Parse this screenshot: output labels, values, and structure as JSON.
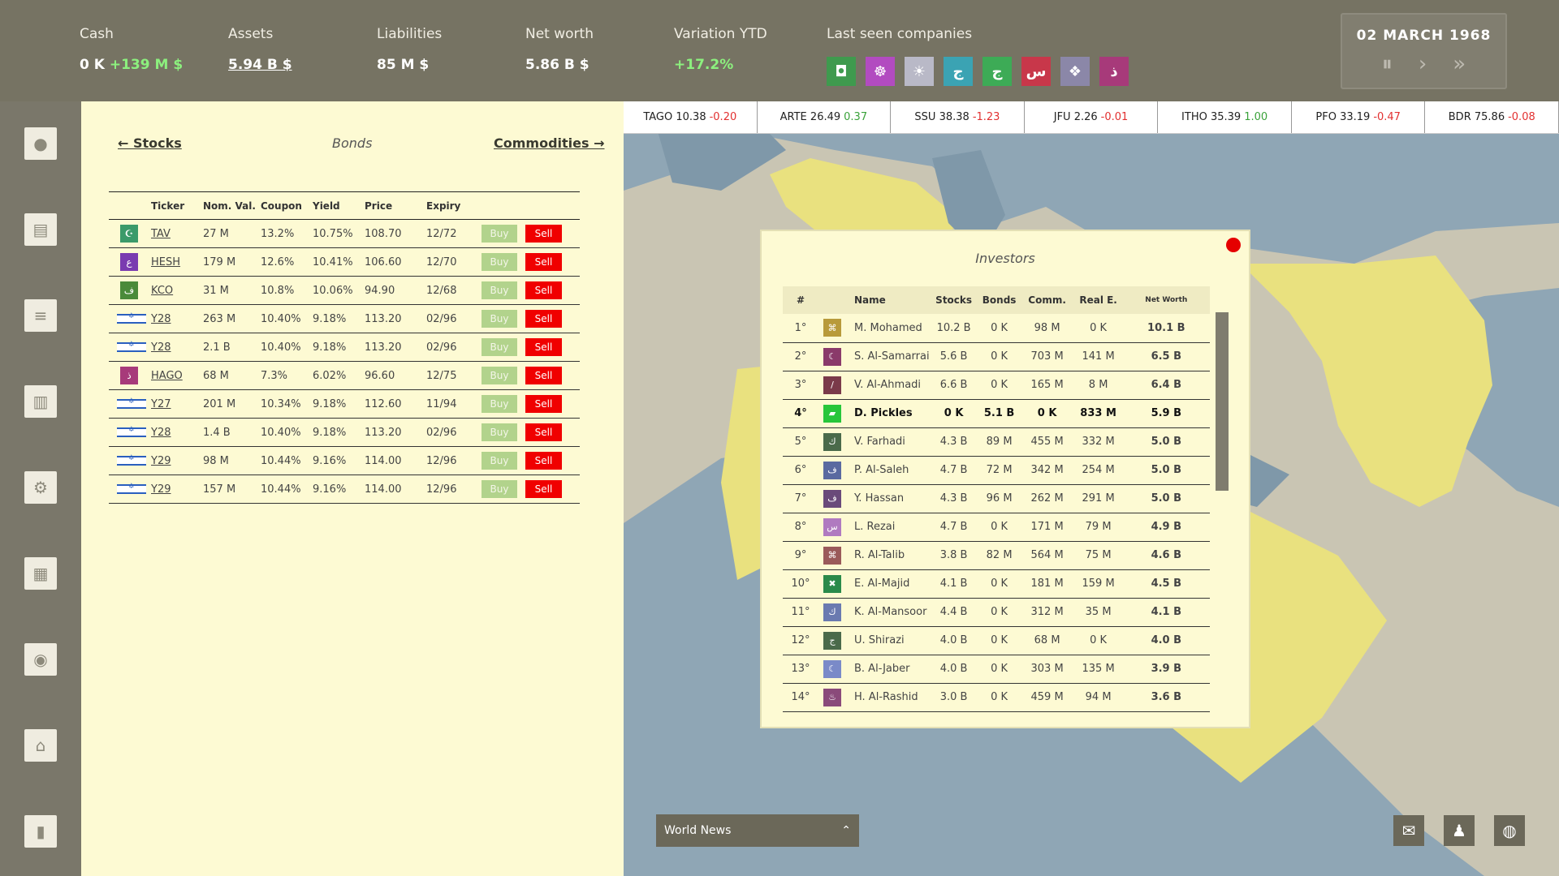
{
  "header": {
    "cash_label": "Cash",
    "cash_value": "0 K",
    "cash_change": "+139 M $",
    "assets_label": "Assets",
    "assets_value": "5.94 B $",
    "liabilities_label": "Liabilities",
    "liabilities_value": "85 M $",
    "networth_label": "Net worth",
    "networth_value": "5.86 B $",
    "variation_label": "Variation YTD",
    "variation_value": "+17.2%",
    "lastseen_label": "Last seen companies",
    "companies": [
      {
        "icon": "◘",
        "color": "#3f9a4e"
      },
      {
        "icon": "☸",
        "color": "#b24bc0"
      },
      {
        "icon": "☀",
        "color": "#b9b9c7"
      },
      {
        "icon": "ج",
        "color": "#3ba3b3"
      },
      {
        "icon": "ج",
        "color": "#3dab56"
      },
      {
        "icon": "س",
        "color": "#c8374a"
      },
      {
        "icon": "❖",
        "color": "#8b87a8"
      },
      {
        "icon": "ذ",
        "color": "#a73a7a"
      }
    ]
  },
  "date": {
    "text": "02 MARCH 1968",
    "pause": "⏸",
    "play": "›",
    "fast": "»"
  },
  "sidebar": [
    "person-icon",
    "document-icon",
    "database-icon",
    "news-icon",
    "gear-icon",
    "building-icon",
    "money-bag-icon",
    "bank-icon",
    "chart-icon"
  ],
  "nav": {
    "stocks": "← Stocks",
    "bonds": "Bonds",
    "commodities": "Commodities →"
  },
  "bonds": {
    "headers": [
      "Ticker",
      "Nom. Val.",
      "Coupon",
      "Yield",
      "Price",
      "Expiry"
    ],
    "buy_label": "Buy",
    "sell_label": "Sell",
    "rows": [
      {
        "ticker": "TAV",
        "nom": "27 M",
        "coupon": "13.2%",
        "yield": "10.75%",
        "price": "108.70",
        "expiry": "12/72",
        "icon": "☪",
        "color": "#3b9a6a"
      },
      {
        "ticker": "HESH",
        "nom": "179 M",
        "coupon": "12.6%",
        "yield": "10.41%",
        "price": "106.60",
        "expiry": "12/70",
        "icon": "ع",
        "color": "#7a3bb0"
      },
      {
        "ticker": "KCO",
        "nom": "31 M",
        "coupon": "10.8%",
        "yield": "10.06%",
        "price": "94.90",
        "expiry": "12/68",
        "icon": "ﻑ",
        "color": "#4a8a3a"
      },
      {
        "ticker": "Y28",
        "nom": "263 M",
        "coupon": "10.40%",
        "yield": "9.18%",
        "price": "113.20",
        "expiry": "02/96",
        "icon": "",
        "color": "flag"
      },
      {
        "ticker": "Y28",
        "nom": "2.1 B",
        "coupon": "10.40%",
        "yield": "9.18%",
        "price": "113.20",
        "expiry": "02/96",
        "icon": "",
        "color": "flag"
      },
      {
        "ticker": "HAGO",
        "nom": "68 M",
        "coupon": "7.3%",
        "yield": "6.02%",
        "price": "96.60",
        "expiry": "12/75",
        "icon": "ذ",
        "color": "#a73a7a"
      },
      {
        "ticker": "Y27",
        "nom": "201 M",
        "coupon": "10.34%",
        "yield": "9.18%",
        "price": "112.60",
        "expiry": "11/94",
        "icon": "",
        "color": "flag"
      },
      {
        "ticker": "Y28",
        "nom": "1.4 B",
        "coupon": "10.40%",
        "yield": "9.18%",
        "price": "113.20",
        "expiry": "02/96",
        "icon": "",
        "color": "flag"
      },
      {
        "ticker": "Y29",
        "nom": "98 M",
        "coupon": "10.44%",
        "yield": "9.16%",
        "price": "114.00",
        "expiry": "12/96",
        "icon": "",
        "color": "flag"
      },
      {
        "ticker": "Y29",
        "nom": "157 M",
        "coupon": "10.44%",
        "yield": "9.16%",
        "price": "114.00",
        "expiry": "12/96",
        "icon": "",
        "color": "flag"
      }
    ]
  },
  "ticker": [
    {
      "sym": "TAGO",
      "price": "10.38",
      "chg": "-0.20",
      "dir": "neg"
    },
    {
      "sym": "ARTE",
      "price": "26.49",
      "chg": "0.37",
      "dir": "pos"
    },
    {
      "sym": "SSU",
      "price": "38.38",
      "chg": "-1.23",
      "dir": "neg"
    },
    {
      "sym": "JFU",
      "price": "2.26",
      "chg": "-0.01",
      "dir": "neg"
    },
    {
      "sym": "ITHO",
      "price": "35.39",
      "chg": "1.00",
      "dir": "pos"
    },
    {
      "sym": "PFO",
      "price": "33.19",
      "chg": "-0.47",
      "dir": "neg"
    },
    {
      "sym": "BDR",
      "price": "75.86",
      "chg": "-0.08",
      "dir": "neg"
    }
  ],
  "investors": {
    "title": "Investors",
    "headers": [
      "#",
      "",
      "Name",
      "Stocks",
      "Bonds",
      "Comm.",
      "Real E.",
      "Net Worth"
    ],
    "rows": [
      {
        "rank": "1°",
        "name": "M. Mohamed",
        "stocks": "10.2 B",
        "bonds": "0 K",
        "comm": "98 M",
        "re": "0 K",
        "nw": "10.1 B",
        "icon": "⌘",
        "color": "#b89a3a"
      },
      {
        "rank": "2°",
        "name": "S. Al-Samarrai",
        "stocks": "5.6 B",
        "bonds": "0 K",
        "comm": "703 M",
        "re": "141 M",
        "nw": "6.5 B",
        "icon": "☾",
        "color": "#8a3a6a"
      },
      {
        "rank": "3°",
        "name": "V. Al-Ahmadi",
        "stocks": "6.6 B",
        "bonds": "0 K",
        "comm": "165 M",
        "re": "8 M",
        "nw": "6.4 B",
        "icon": "/",
        "color": "#7a3a4a"
      },
      {
        "rank": "4°",
        "name": "D. Pickles",
        "stocks": "0 K",
        "bonds": "5.1 B",
        "comm": "0 K",
        "re": "833 M",
        "nw": "5.9 B",
        "icon": "▰",
        "color": "#27c63a",
        "me": true
      },
      {
        "rank": "5°",
        "name": "V. Farhadi",
        "stocks": "4.3 B",
        "bonds": "89 M",
        "comm": "455 M",
        "re": "332 M",
        "nw": "5.0 B",
        "icon": "ﻙ",
        "color": "#4a6a4a"
      },
      {
        "rank": "6°",
        "name": "P. Al-Saleh",
        "stocks": "4.7 B",
        "bonds": "72 M",
        "comm": "342 M",
        "re": "254 M",
        "nw": "5.0 B",
        "icon": "ﻑ",
        "color": "#5a6aa0"
      },
      {
        "rank": "7°",
        "name": "Y. Hassan",
        "stocks": "4.3 B",
        "bonds": "96 M",
        "comm": "262 M",
        "re": "291 M",
        "nw": "5.0 B",
        "icon": "ﻑ",
        "color": "#6a4a7a"
      },
      {
        "rank": "8°",
        "name": "L. Rezai",
        "stocks": "4.7 B",
        "bonds": "0 K",
        "comm": "171 M",
        "re": "79 M",
        "nw": "4.9 B",
        "icon": "س",
        "color": "#b07ac0"
      },
      {
        "rank": "9°",
        "name": "R. Al-Talib",
        "stocks": "3.8 B",
        "bonds": "82 M",
        "comm": "564 M",
        "re": "75 M",
        "nw": "4.6 B",
        "icon": "⌘",
        "color": "#9a5a5a"
      },
      {
        "rank": "10°",
        "name": "E. Al-Majid",
        "stocks": "4.1 B",
        "bonds": "0 K",
        "comm": "181 M",
        "re": "159 M",
        "nw": "4.5 B",
        "icon": "✖",
        "color": "#2a8a4a"
      },
      {
        "rank": "11°",
        "name": "K. Al-Mansoor",
        "stocks": "4.4 B",
        "bonds": "0 K",
        "comm": "312 M",
        "re": "35 M",
        "nw": "4.1 B",
        "icon": "ك",
        "color": "#6a7ab0"
      },
      {
        "rank": "12°",
        "name": "U. Shirazi",
        "stocks": "4.0 B",
        "bonds": "0 K",
        "comm": "68 M",
        "re": "0 K",
        "nw": "4.0 B",
        "icon": "ج",
        "color": "#4a6a4a"
      },
      {
        "rank": "13°",
        "name": "B. Al-Jaber",
        "stocks": "4.0 B",
        "bonds": "0 K",
        "comm": "303 M",
        "re": "135 M",
        "nw": "3.9 B",
        "icon": "☾",
        "color": "#7a8ac8"
      },
      {
        "rank": "14°",
        "name": "H. Al-Rashid",
        "stocks": "3.0 B",
        "bonds": "0 K",
        "comm": "459 M",
        "re": "94 M",
        "nw": "3.6 B",
        "icon": "♨",
        "color": "#8a4a7a"
      }
    ]
  },
  "news": {
    "label": "World News",
    "chevron": "⌃"
  },
  "map_buttons": [
    "mail-icon",
    "advisor-icon",
    "globe-icon"
  ]
}
